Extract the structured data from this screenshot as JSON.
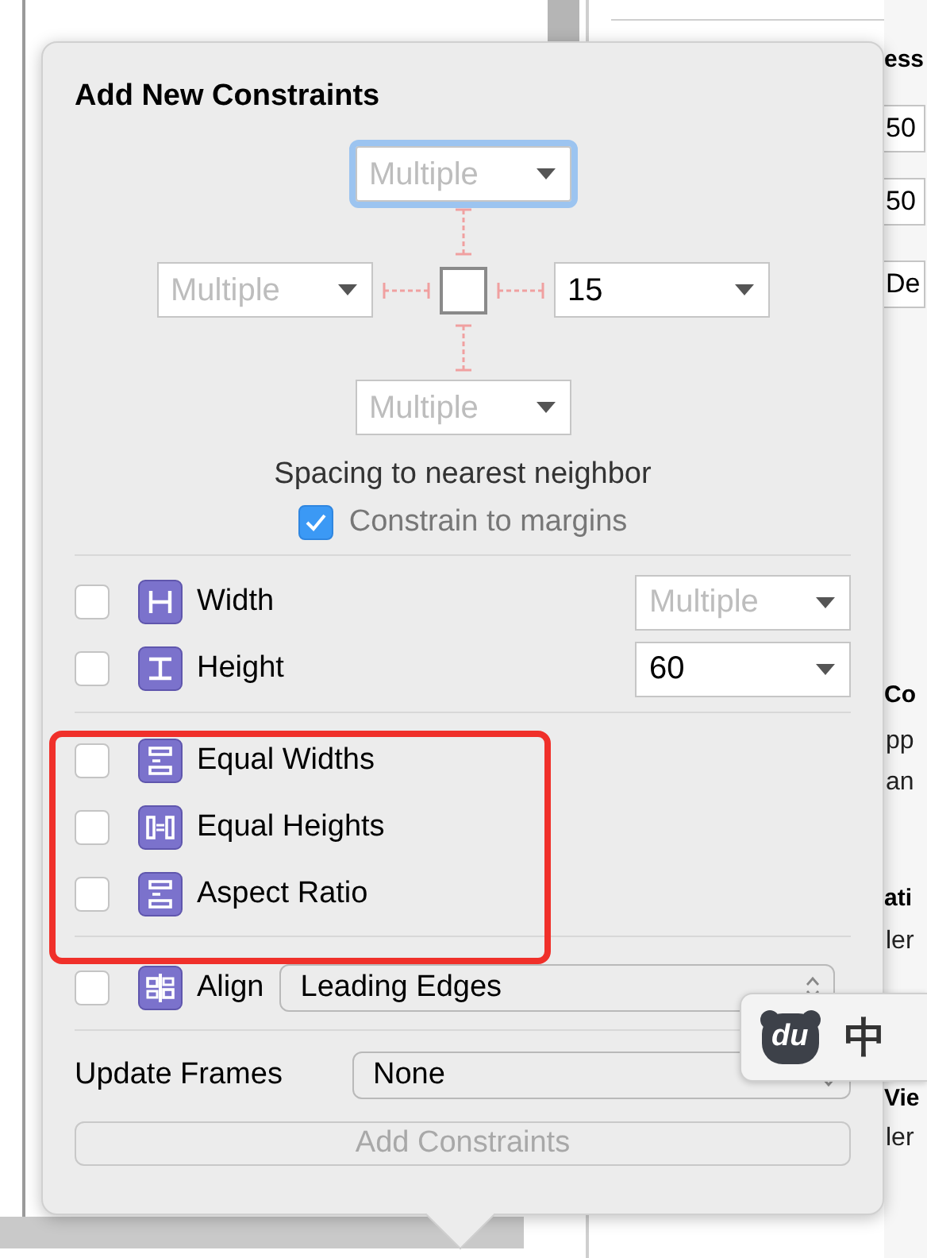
{
  "title": "Add New Constraints",
  "spacing": {
    "top": {
      "value": "Multiple",
      "mixed": true,
      "focused": true,
      "pinned": false
    },
    "left": {
      "value": "Multiple",
      "mixed": true,
      "focused": false,
      "pinned": false
    },
    "right": {
      "value": "15",
      "mixed": false,
      "focused": false,
      "pinned": false
    },
    "bottom": {
      "value": "Multiple",
      "mixed": true,
      "focused": false,
      "pinned": false
    }
  },
  "spacing_caption": "Spacing to nearest neighbor",
  "constrain_to_margins": {
    "label": "Constrain to margins",
    "checked": true
  },
  "sections": [
    [
      {
        "kind": "width",
        "label": "Width",
        "checked": false,
        "value": "Multiple",
        "mixed": true
      },
      {
        "kind": "height",
        "label": "Height",
        "checked": false,
        "value": "60",
        "mixed": false
      }
    ],
    [
      {
        "kind": "equal-widths",
        "label": "Equal Widths",
        "checked": false
      },
      {
        "kind": "equal-heights",
        "label": "Equal Heights",
        "checked": false
      },
      {
        "kind": "aspect-ratio",
        "label": "Aspect Ratio",
        "checked": false
      }
    ],
    [
      {
        "kind": "align",
        "label": "Align",
        "checked": false,
        "value": "Leading Edges"
      }
    ]
  ],
  "update_frames": {
    "label": "Update Frames",
    "value": "None"
  },
  "add_button": {
    "label": "Add Constraints",
    "disabled": true
  },
  "inspector_fragments": [
    {
      "kind": "heading",
      "text": "ess"
    },
    {
      "kind": "field",
      "text": "50"
    },
    {
      "kind": "field",
      "text": "50"
    },
    {
      "kind": "field",
      "text": "De"
    },
    {
      "kind": "heading",
      "text": "Co"
    },
    {
      "kind": "text",
      "text": "pp"
    },
    {
      "kind": "text",
      "text": "an"
    },
    {
      "kind": "heading",
      "text": "ati"
    },
    {
      "kind": "text",
      "text": "ler"
    },
    {
      "kind": "heading",
      "text": "Vie"
    },
    {
      "kind": "text",
      "text": "ler"
    }
  ],
  "input_method": {
    "logo": "du",
    "mode": "中"
  }
}
